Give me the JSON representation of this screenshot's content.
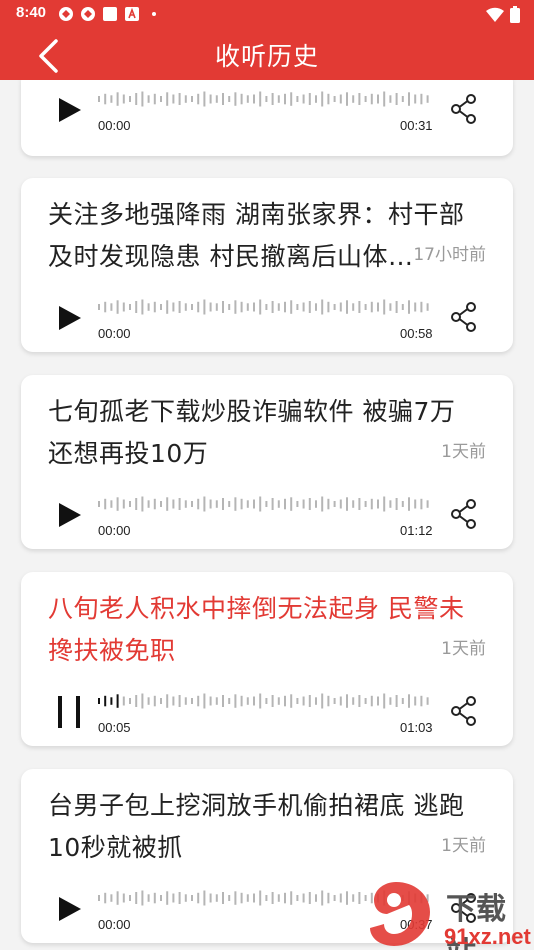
{
  "status_bar": {
    "time": "8:40",
    "icons": [
      "app-icon-1",
      "app-icon-2",
      "square-icon",
      "a-icon",
      "dot-icon"
    ],
    "right_icons": [
      "wifi-icon",
      "battery-icon"
    ]
  },
  "header": {
    "title": "收听历史",
    "back_icon": "chevron-left-icon"
  },
  "colors": {
    "accent": "#e23a34",
    "text": "#222222",
    "muted": "#9a9a9a"
  },
  "items": [
    {
      "title": "",
      "time_ago": "",
      "state": "paused",
      "position": "00:00",
      "duration": "00:31",
      "progress": 0
    },
    {
      "title": "关注多地强降雨 湖南张家界：村干部及时发现隐患 村民撤离后山体…",
      "time_ago": "17小时前",
      "state": "paused",
      "position": "00:00",
      "duration": "00:58",
      "progress": 0
    },
    {
      "title": "七旬孤老下载炒股诈骗软件 被骗7万还想再投10万",
      "time_ago": "1天前",
      "state": "paused",
      "position": "00:00",
      "duration": "01:12",
      "progress": 0
    },
    {
      "title": "八旬老人积水中摔倒无法起身 民警未搀扶被免职",
      "time_ago": "1天前",
      "state": "playing",
      "position": "00:05",
      "duration": "01:03",
      "progress": 0.08
    },
    {
      "title": "台男子包上挖洞放手机偷拍裙底 逃跑10秒就被抓",
      "time_ago": "1天前",
      "state": "paused",
      "position": "00:00",
      "duration": "00:37",
      "progress": 0
    }
  ],
  "watermark": {
    "brand_top": "下载站",
    "brand_bottom": "91xz.net"
  }
}
